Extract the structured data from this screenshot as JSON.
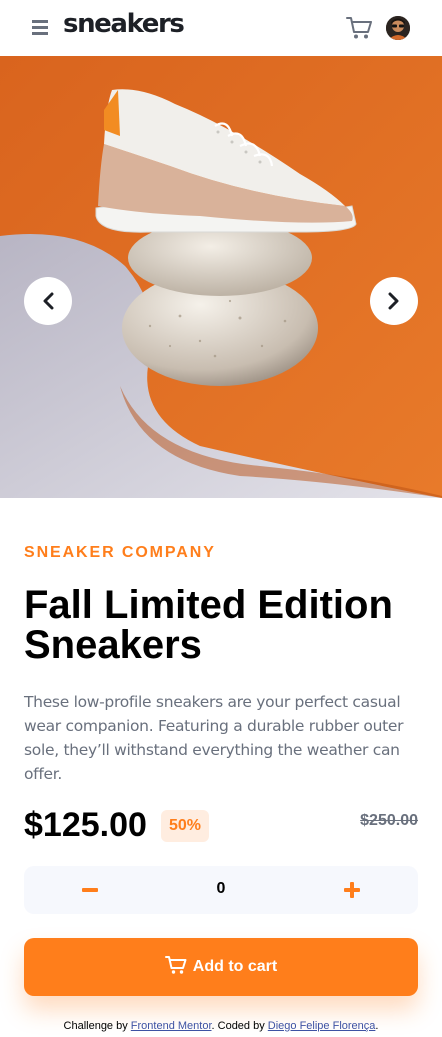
{
  "header": {
    "logo": "sneakers",
    "menu_icon": "hamburger-menu-icon",
    "cart_icon": "cart-icon",
    "avatar": "user-avatar"
  },
  "hero": {
    "prev_icon": "chevron-left-icon",
    "next_icon": "chevron-right-icon"
  },
  "product": {
    "company": "SNEAKER COMPANY",
    "title": "Fall Limited Edition Sneakers",
    "description": "These low-profile sneakers are your perfect casual wear companion. Featuring a durable rubber outer sole, they’ll withstand everything the weather can offer.",
    "price": "$125.00",
    "discount": "50%",
    "old_price": "$250.00"
  },
  "quantity": {
    "value": "0",
    "minus_icon": "minus-icon",
    "plus_icon": "plus-icon"
  },
  "add_to_cart": {
    "label": "Add to cart",
    "icon": "cart-icon"
  },
  "attribution": {
    "prefix": "Challenge by ",
    "challenge_link": "Frontend Mentor",
    "middle": ". Coded by ",
    "author_link": "Diego Felipe Florença",
    "suffix": "."
  },
  "colors": {
    "accent": "#ff7e1b",
    "accent_pale": "#ffede0",
    "text_dark": "#1d2026",
    "text_grey": "#69707d",
    "qty_bg": "#f6f8fd"
  }
}
